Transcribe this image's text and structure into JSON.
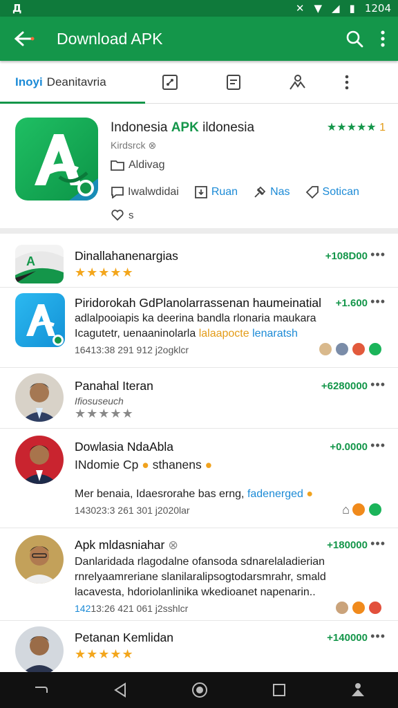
{
  "status": {
    "left": "Д",
    "time": "1204"
  },
  "appbar": {
    "title": "Download APK"
  },
  "tabs": {
    "active_k1": "Inoyi",
    "active_k2": "Deanitavria"
  },
  "hero": {
    "title_a": "Indonesia",
    "title_apk": "APK",
    "title_b": "ildonesia",
    "rating_stars": "★★★★★",
    "rating_count": "1",
    "subtitle": "Kirdsrck",
    "folder": "Aldivag",
    "actions": [
      "Iwalwdidai",
      "Ruan",
      "Nas",
      "Sotican"
    ],
    "likes": "s"
  },
  "items": [
    {
      "title": "Dinallahanenargias",
      "price": "+108D00",
      "stars": "★★★★★"
    },
    {
      "title": "Piridorokah GdPlanolarrassenan haumeinatial",
      "price": "+1.600",
      "line1": "adlalpooiapis ka deerina bandla rlonaria maukara",
      "line2a": "Icagutetr, uenaaninolarla",
      "line2b": "lalaapocte",
      "line2c": "lenaratsh",
      "meta": "16413:38 291 912  j2ogklcr"
    },
    {
      "title": "Panahal Iteran",
      "price": "+6280000",
      "sub": "Ifiosuseuch",
      "stars": "★★★★★"
    },
    {
      "title": "Dowlasia NdaAbla",
      "price": "+0.0000",
      "line1": "INdomie Cp",
      "line1b": "sthanens",
      "line2a": "Mer benaia, Idaesrorahe bas erng,",
      "line2b": "fadenerged",
      "meta": "143023:3 261 301  j2020lar"
    },
    {
      "title": "Apk mldasniahar",
      "price": "+180000",
      "line1": "Danlaridada rlagodalne ofansoda sdnarelaladierian",
      "line2": "rnrelyaamreriane slanilaralipsogtodarsmrahr, smald",
      "line3": "lacavesta, hdoriolanlinika wkedioanet napenarin..",
      "meta_a": "142",
      "meta_b": "13:26 421 061  j2sshlcr"
    },
    {
      "title": "Petanan Kemlidan",
      "price": "+140000",
      "stars": "★★★★★"
    }
  ]
}
